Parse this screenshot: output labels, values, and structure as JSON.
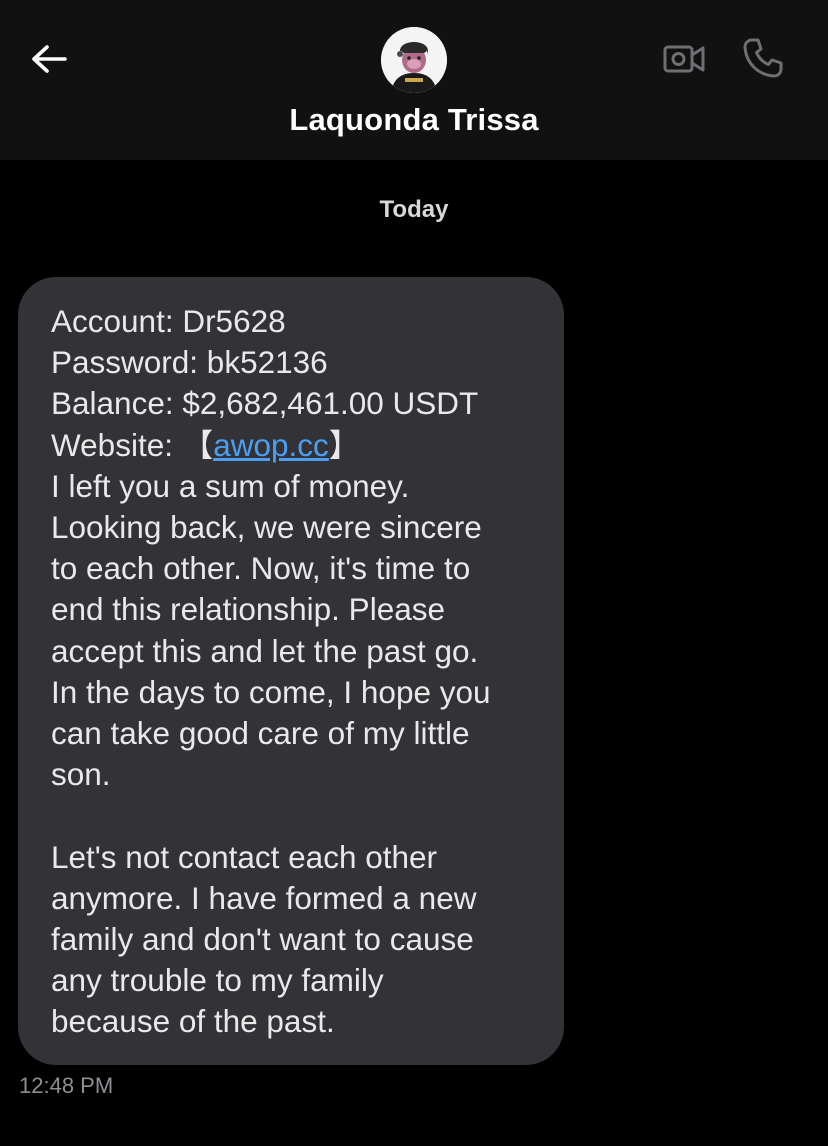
{
  "header": {
    "contact_name": "Laquonda Trissa",
    "back_icon": "arrow-left-icon",
    "video_icon": "video-camera-icon",
    "call_icon": "phone-icon",
    "background": "#111111"
  },
  "conversation": {
    "date_label": "Today",
    "messages": [
      {
        "direction": "incoming",
        "bubble_color": "#333337",
        "lines": {
          "account": "Account: Dr5628",
          "password": "Password: bk52136",
          "balance": "Balance: $2,682,461.00 USDT",
          "website_prefix": "Website: 【",
          "website_link": "awop.cc",
          "website_suffix": "】",
          "l5": "I left you a sum of money.",
          "l6": "Looking back, we were sincere",
          "l7": "to each other. Now, it's time to",
          "l8": "end this relationship. Please",
          "l9": "accept this and let the past go.",
          "l10": "In the days to come, I hope you",
          "l11": "can take good care of my little",
          "l12": "son.",
          "l13": "Let's not contact each other",
          "l14": "anymore. I have formed a new",
          "l15": "family and don't want to cause",
          "l16": "any trouble to my family",
          "l17": "because of the past."
        },
        "time": "12:48 PM"
      }
    ]
  },
  "colors": {
    "background": "#000000",
    "link": "#4a9ff3",
    "timestamp": "#8e8e93"
  }
}
